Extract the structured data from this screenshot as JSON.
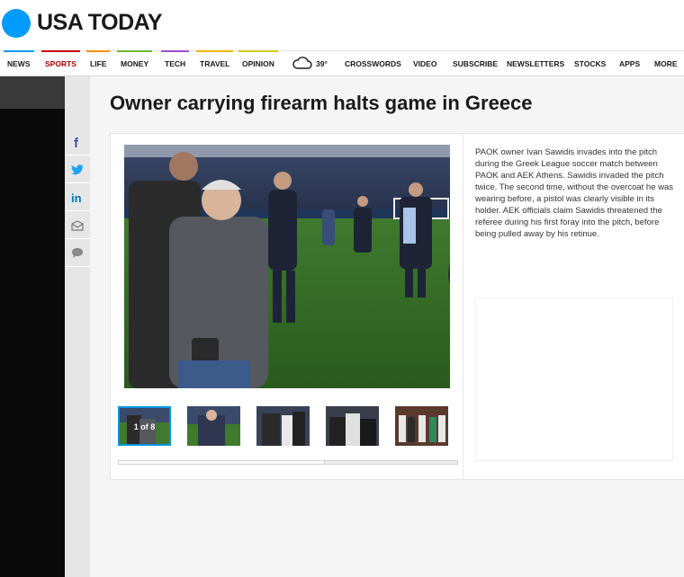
{
  "brand": {
    "name": "USA TODAY",
    "color": "#009bff"
  },
  "nav": {
    "items": [
      {
        "label": "NEWS",
        "active": false
      },
      {
        "label": "SPORTS",
        "active": true
      },
      {
        "label": "LIFE",
        "active": false
      },
      {
        "label": "MONEY",
        "active": false
      },
      {
        "label": "TECH",
        "active": false
      },
      {
        "label": "TRAVEL",
        "active": false
      },
      {
        "label": "OPINION",
        "active": false
      },
      {
        "label": "CROSSWORDS",
        "active": false
      },
      {
        "label": "VIDEO",
        "active": false
      },
      {
        "label": "SUBSCRIBE",
        "active": false
      },
      {
        "label": "NEWSLETTERS",
        "active": false
      },
      {
        "label": "STOCKS",
        "active": false
      },
      {
        "label": "APPS",
        "active": false
      },
      {
        "label": "MORE",
        "active": false
      }
    ],
    "weather": {
      "temp": "39°",
      "icon": "cloud-icon"
    }
  },
  "share": [
    "facebook-icon",
    "twitter-icon",
    "linkedin-icon",
    "email-icon",
    "comment-icon"
  ],
  "article": {
    "title": "Owner carrying firearm halts game in Greece",
    "caption": "PAOK owner Ivan Sawidis invades into the pitch during the Greek League soccer match between PAOK and AEK Athens. Sawidis invaded the pitch twice. The second time, without the overcoat he was wearing before, a pistol was clearly visible in its holder. AEK officials claim Sawidis threatened the referee during his first foray into the pitch, before being pulled away by his retinue."
  },
  "gallery": {
    "counter": "1 of 8",
    "thumb_count": 5,
    "scroll_position": 0.61
  }
}
